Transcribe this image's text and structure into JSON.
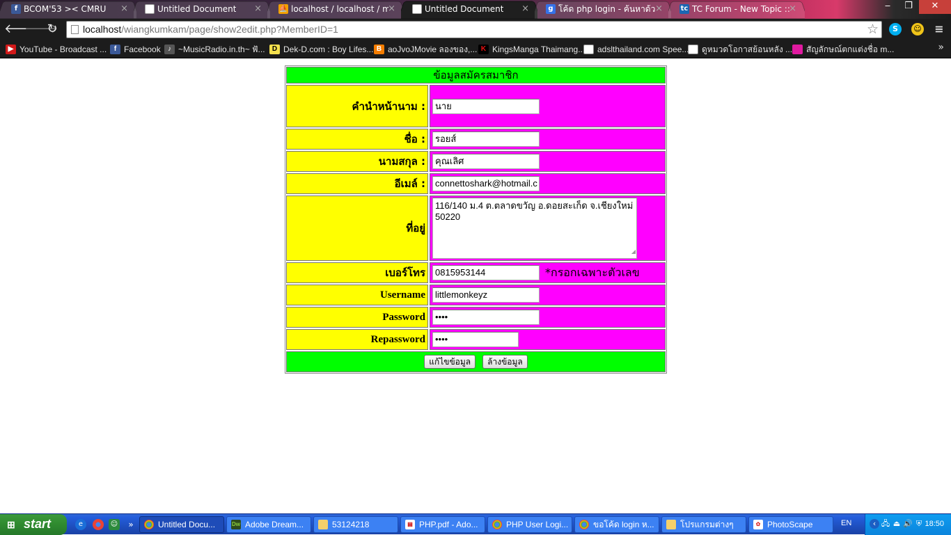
{
  "browser": {
    "tabs": [
      {
        "title": "BCOM'53 >< CMRU",
        "favicon": "facebook-icon"
      },
      {
        "title": "Untitled Document",
        "favicon": "document-icon"
      },
      {
        "title": "localhost / localhost / member",
        "favicon": "phpmyadmin-icon"
      },
      {
        "title": "Untitled Document",
        "favicon": "document-icon"
      },
      {
        "title": "โค้ด php login - ค้นหาด้วย Goo",
        "favicon": "google-icon"
      },
      {
        "title": "TC Forum - New Topic :: เริ่มท",
        "favicon": "forum-icon"
      }
    ],
    "window_controls": {
      "minimize": "‒",
      "restore": "❐",
      "close": "✕"
    },
    "url_host": "localhost",
    "url_path": "/wiangkumkam/page/show2edit.php?MemberID=1",
    "bookmarks": [
      {
        "label": "YouTube - Broadcast ...",
        "icon": "youtube-icon"
      },
      {
        "label": "Facebook",
        "icon": "facebook-icon"
      },
      {
        "label": "~MusicRadio.in.th~ ฟั...",
        "icon": "music-radio-icon"
      },
      {
        "label": "Dek-D.com : Boy Lifes...",
        "icon": "dekd-icon"
      },
      {
        "label": "aoJvoJMovie ลองของ,...",
        "icon": "blogger-icon"
      },
      {
        "label": "KingsManga Thaimang...",
        "icon": "kingsmanga-icon"
      },
      {
        "label": "adslthailand.com Spee...",
        "icon": "page-icon"
      },
      {
        "label": "ดูหมวดโอกาสย้อนหลัง ...",
        "icon": "page-icon"
      },
      {
        "label": "สัญลักษณ์ตกแต่งชื่อ m...",
        "icon": "pink-dot-icon"
      }
    ]
  },
  "form": {
    "heading": "ข้อมูลสมัครสมาชิก",
    "fields": {
      "prefix": {
        "label": "คำนำหน้านาม :",
        "value": "นาย"
      },
      "firstname": {
        "label": "ชื่อ :",
        "value": "รอยส์"
      },
      "lastname": {
        "label": "นามสกุล :",
        "value": "คุณเลิศ"
      },
      "email": {
        "label": "อีเมล์ :",
        "value": "connettoshark@hotmail.c"
      },
      "address": {
        "label": "ที่อยู่",
        "value": "116/140 ม.4 ต.ตลาดขวัญ อ.ดอยสะเก็ด จ.เชียงใหม่\n50220"
      },
      "phone": {
        "label": "เบอร์โทร",
        "value": "0815953144",
        "note": "*กรอกเฉพาะตัวเลข"
      },
      "username": {
        "label": "Username",
        "value": "littlemonkeyz"
      },
      "password": {
        "label": "Password",
        "value": "••••"
      },
      "repassword": {
        "label": "Repassword",
        "value": "••••"
      }
    },
    "buttons": {
      "edit": "แก้ไขข้อมูล",
      "reset": "ล้างข้อมูล"
    }
  },
  "taskbar": {
    "start_label": "start",
    "tasks": [
      {
        "label": "Untitled Docu...",
        "icon": "chrome-icon"
      },
      {
        "label": "Adobe Dream...",
        "icon": "dreamweaver-icon"
      },
      {
        "label": "53124218",
        "icon": "folder-icon"
      },
      {
        "label": "PHP.pdf - Ado...",
        "icon": "pdf-icon"
      },
      {
        "label": "PHP User Logi...",
        "icon": "chrome-icon"
      },
      {
        "label": "ขอโค้ด login ห...",
        "icon": "chrome-icon"
      },
      {
        "label": "โปรแกรมต่างๆ",
        "icon": "folder-icon"
      },
      {
        "label": "PhotoScape",
        "icon": "photoscape-icon"
      }
    ],
    "language": "EN",
    "clock": "18:50"
  }
}
